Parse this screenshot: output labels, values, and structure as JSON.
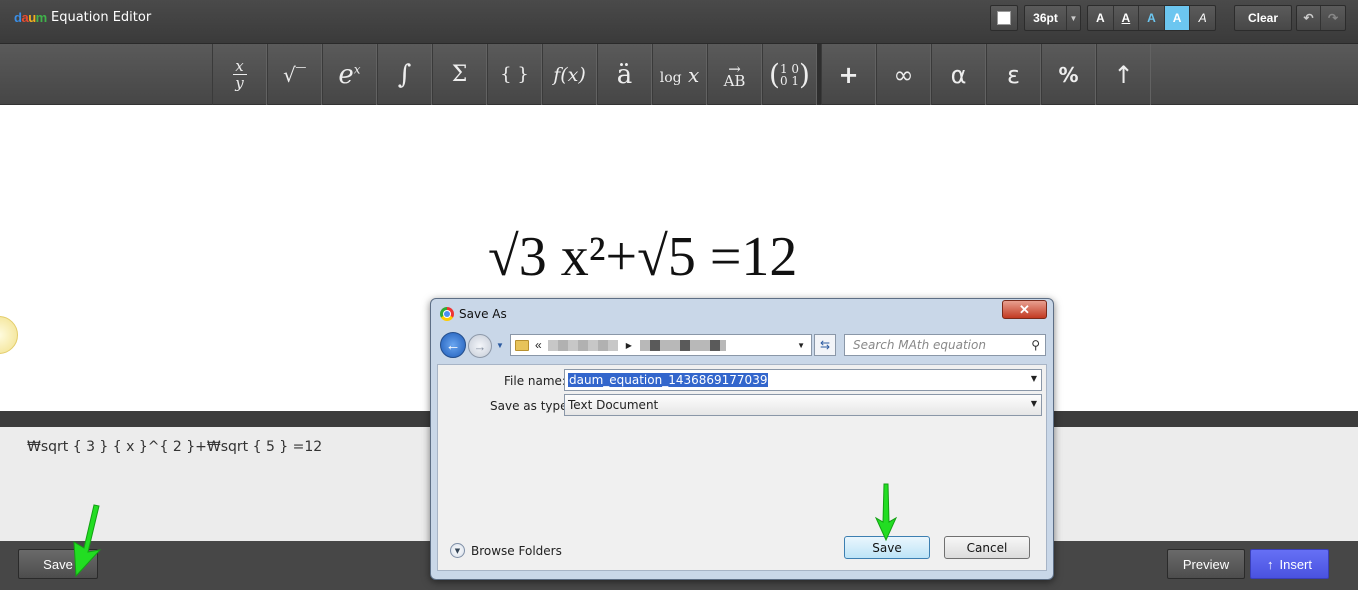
{
  "app": {
    "logo": "daum",
    "title": "Equation Editor"
  },
  "toolbar_top": {
    "color_swatch": "#ffffff",
    "font_size": "36pt",
    "style_buttons": [
      "A",
      "A",
      "A",
      "A",
      "A"
    ],
    "clear_label": "Clear",
    "undo_icon": "undo-icon",
    "redo_icon": "redo-icon"
  },
  "symbols": {
    "left": [
      "x/y",
      "√‾",
      "eˣ",
      "∫",
      "Σ",
      "{ }",
      "f(x)",
      "ä",
      "log x",
      "AB→",
      "(1 0 / 0 1)"
    ],
    "right": [
      "+",
      "∞",
      "α",
      "ε",
      "%",
      "↑"
    ]
  },
  "equation": {
    "rendered": "√3 x²+√5 =12"
  },
  "source": {
    "text": "₩sqrt { 3 } { x }^{ 2 }+₩sqrt { 5 } =12"
  },
  "bottom": {
    "save_label": "Save",
    "preview_label": "Preview",
    "insert_label": "Insert"
  },
  "dialog": {
    "title": "Save As",
    "address_prefix": "«",
    "search_placeholder": "Search MAth equation",
    "file_name_label": "File name:",
    "file_name_value": "daum_equation_1436869177039",
    "save_type_label": "Save as type:",
    "save_type_value": "Text Document",
    "browse_label": "Browse Folders",
    "save_label": "Save",
    "cancel_label": "Cancel"
  },
  "colors": {
    "insert_blue": "#5058e8",
    "arrow_green": "#22dd22"
  }
}
